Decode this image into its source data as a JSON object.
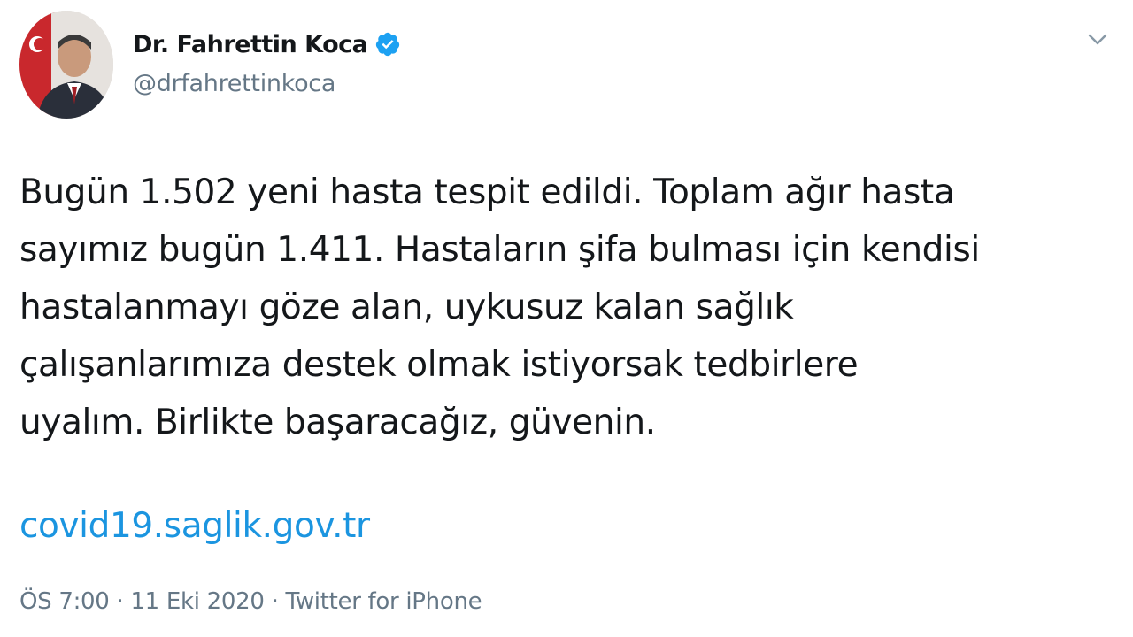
{
  "author": {
    "display_name": "Dr. Fahrettin Koca",
    "handle": "@drfahrettinkoca",
    "verified": true,
    "avatar_icon": "profile-photo"
  },
  "tweet": {
    "lines": [
      "Bugün 1.502 yeni hasta tespit edildi. Toplam ağır hasta",
      "sayımız bugün 1.411. Hastaların şifa bulması için kendisi",
      "hastalanmayı göze alan, uykusuz kalan sağlık",
      "çalışanlarımıza destek olmak istiyorsak tedbirlere",
      "uyalım. Birlikte başaracağız, güvenin."
    ],
    "link": "covid19.saglik.gov.tr"
  },
  "meta": {
    "time": "ÖS 7:00",
    "date": "11 Eki 2020",
    "source": "Twitter for iPhone",
    "separator": "·"
  },
  "colors": {
    "text": "#14171a",
    "secondary": "#657786",
    "link": "#1b95e0",
    "verified_badge": "#1da1f2"
  },
  "icons": {
    "verified": "verified-badge-icon",
    "menu": "chevron-down-icon"
  }
}
